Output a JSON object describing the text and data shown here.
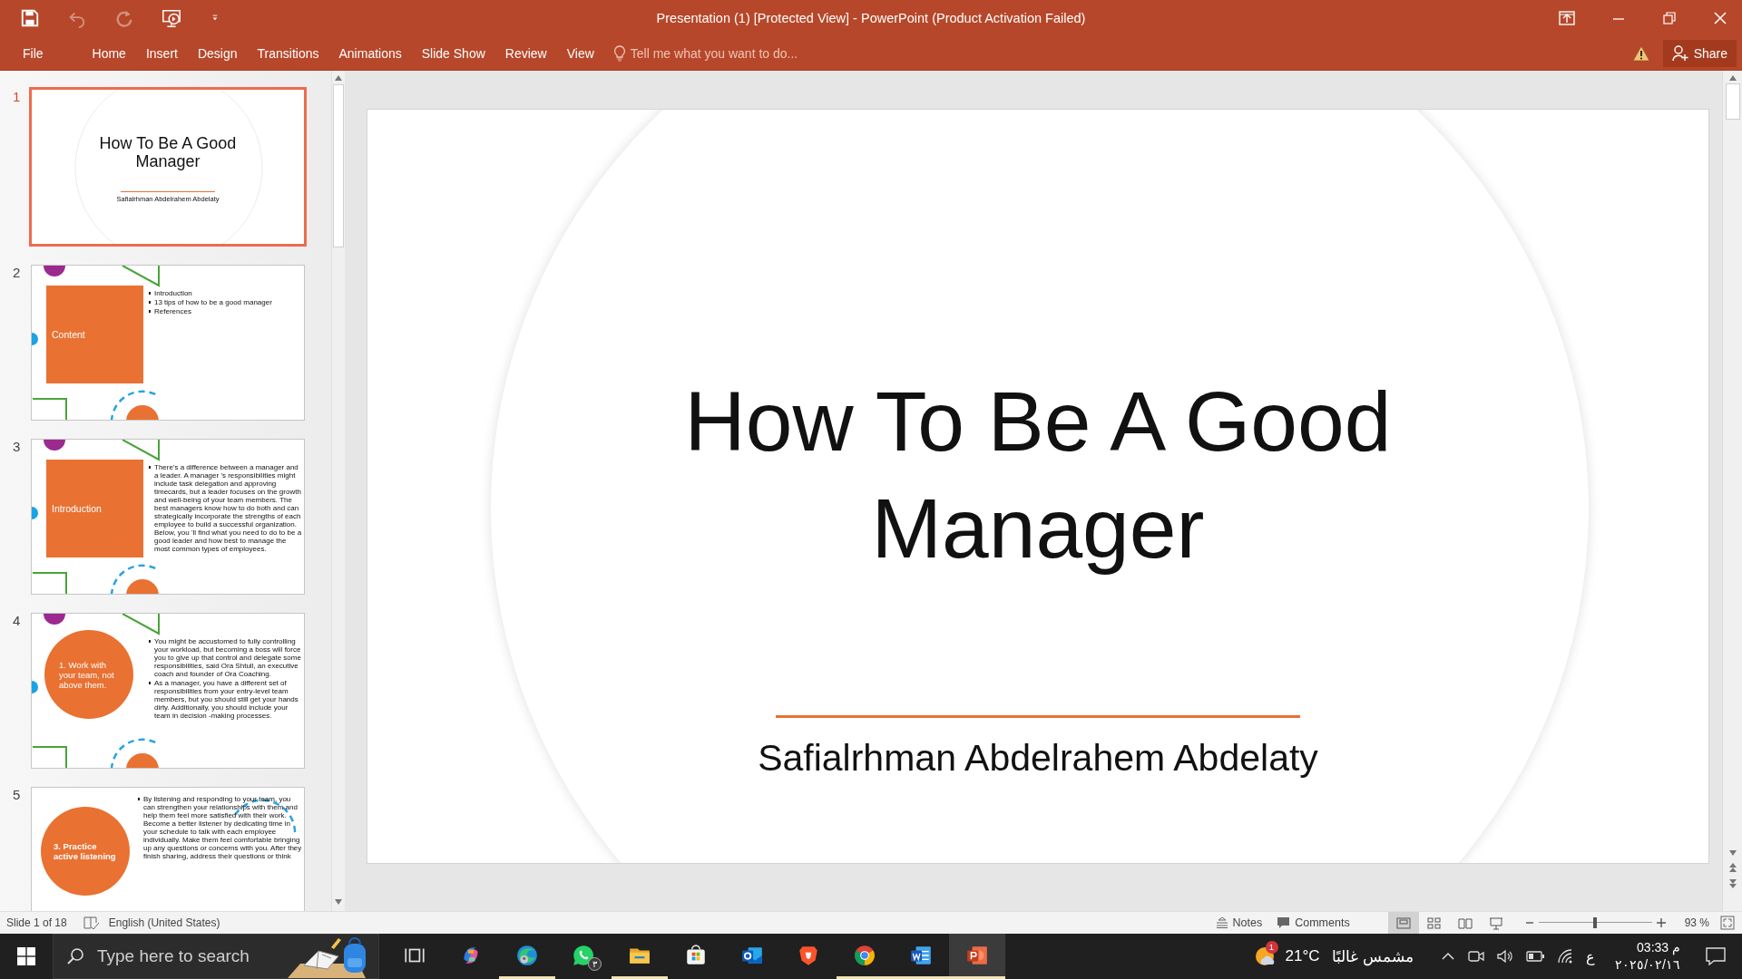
{
  "window": {
    "title": "Presentation (1) [Protected View] - PowerPoint (Product Activation Failed)"
  },
  "quick_access": [
    {
      "kind": "save",
      "disabled": false
    },
    {
      "kind": "undo",
      "disabled": true
    },
    {
      "kind": "redo",
      "disabled": true
    },
    {
      "kind": "start_show",
      "disabled": false
    },
    {
      "kind": "customize",
      "disabled": false
    }
  ],
  "ribbon": {
    "tabs": [
      "File",
      "Home",
      "Insert",
      "Design",
      "Transitions",
      "Animations",
      "Slide Show",
      "Review",
      "View"
    ],
    "tell_me": {
      "placeholder": "Tell me what you want to do..."
    },
    "share": "Share"
  },
  "thumbnails": [
    {
      "number": "1",
      "selected": true,
      "kind": "title",
      "title": "How To Be A Good Manager",
      "subtitle": "Safialrhman Abdelrahem Abdelaty"
    },
    {
      "number": "2",
      "selected": false,
      "kind": "square",
      "heading": "Content",
      "bullets": [
        "Introduction",
        "13 tips of how to be a good manager",
        "References"
      ]
    },
    {
      "number": "3",
      "selected": false,
      "kind": "square",
      "heading": "Introduction",
      "bullets": [
        "There's a difference between a manager and a leader. A manager 's responsibilities might include task delegation and approving timecards, but a leader focuses on the growth and well-being of your team members. The best managers know how to do both and can strategically incorporate the strengths of each employee to build a successful organization. Below, you 'll find what you need to do to be a good leader and how best to manage the most common types of employees."
      ]
    },
    {
      "number": "4",
      "selected": false,
      "kind": "circle",
      "heading": "1. Work with your team, not above them.",
      "bullets": [
        "You might be accustomed to fully controlling your workload, but becoming a boss will force you to give up that control and delegate some responsibilities, said Ora Shtull, an executive coach and founder of Ora Coaching.",
        "As a manager, you have a different set of responsibilities from your entry-level team members, but you should still get your hands dirty. Additionally, you should include your team in decision -making processes."
      ]
    },
    {
      "number": "5",
      "selected": false,
      "kind": "circle_top_arc",
      "heading": "3. Practice active listening",
      "bullets": [
        "By listening and responding to your team, you can strengthen your relationships with them and help them feel more satisfied with their work. Become a better listener by dedicating time in your schedule to talk with each employee individually. Make them feel comfortable bringing up any questions or concerns with you. After they finish sharing, address their questions or think"
      ]
    }
  ],
  "slide": {
    "title": "How To Be A Good Manager",
    "subtitle": "Safialrhman Abdelrahem Abdelaty"
  },
  "status_bar": {
    "slide_info": "Slide 1 of 18",
    "language": "English (United States)",
    "notes": "Notes",
    "comments": "Comments",
    "views": [
      {
        "kind": "normal",
        "selected": true
      },
      {
        "kind": "sorter",
        "selected": false
      },
      {
        "kind": "reading",
        "selected": false
      },
      {
        "kind": "slideshow",
        "selected": false
      }
    ],
    "zoom_slider": {
      "level": 0.5
    },
    "zoom": "93 %"
  },
  "taskbar": {
    "search": {
      "placeholder": "Type here to search"
    },
    "apps": [
      {
        "kind": "task_view",
        "running": false,
        "selected": false
      },
      {
        "kind": "copilot",
        "running": false,
        "selected": false
      },
      {
        "kind": "edge",
        "running": true,
        "selected": false
      },
      {
        "kind": "whatsapp",
        "running": false,
        "selected": false,
        "badge": "٣"
      },
      {
        "kind": "explorer",
        "running": true,
        "selected": false
      },
      {
        "kind": "store",
        "running": false,
        "selected": false
      },
      {
        "kind": "outlook",
        "running": false,
        "selected": false
      },
      {
        "kind": "brave",
        "running": false,
        "selected": false
      },
      {
        "kind": "chrome",
        "running": true,
        "selected": false
      },
      {
        "kind": "word",
        "running": true,
        "selected": false
      },
      {
        "kind": "powerpoint",
        "running": true,
        "selected": true
      }
    ],
    "weather": {
      "badge": "1",
      "temperature": "21°C",
      "condition": "مشمس غالبًا"
    },
    "input_language": "ع",
    "time": "03:33 م",
    "date": "٢٠٢٥/٠٢/١٦"
  }
}
